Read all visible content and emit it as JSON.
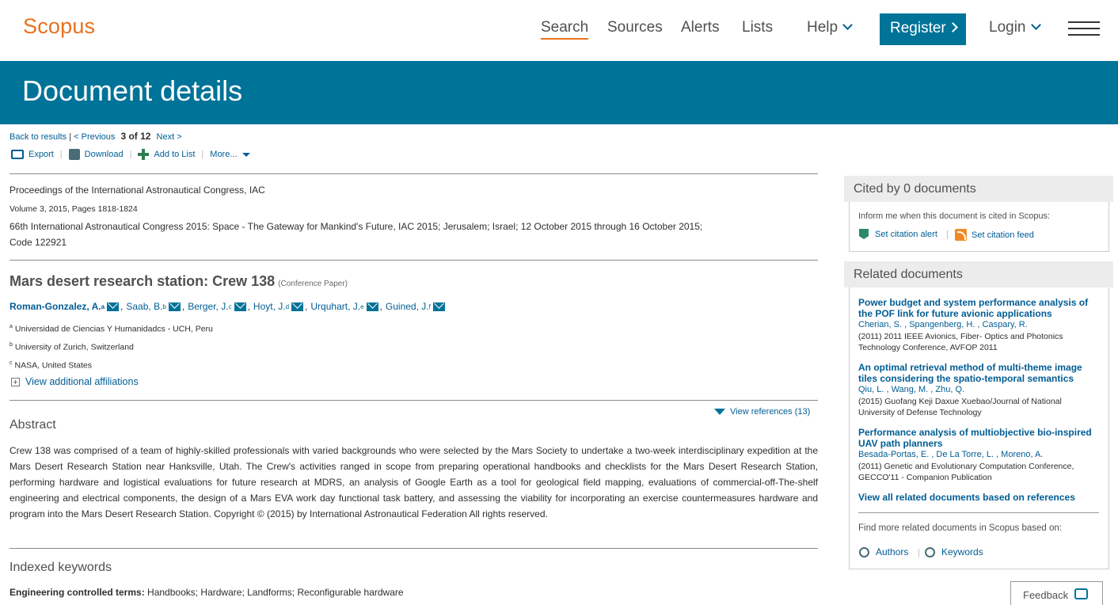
{
  "header": {
    "logo": "Scopus",
    "nav": [
      "Search",
      "Sources",
      "Alerts",
      "Lists"
    ],
    "help": "Help",
    "register": "Register",
    "login": "Login"
  },
  "banner_title": "Document details",
  "results_nav": {
    "back": "Back to results",
    "separator": "|",
    "previous": "< Previous",
    "position": "3 of 12",
    "next": "Next >"
  },
  "toolbar": {
    "export": "Export",
    "download": "Download",
    "add_to_list": "Add to List",
    "more": "More..."
  },
  "source": {
    "journal": "Proceedings of the International Astronautical Congress, IAC",
    "volume": "Volume 3, 2015, Pages 1818-1824",
    "conference_line1": "66th International Astronautical Congress 2015: Space - The Gateway for Mankind's Future, IAC 2015; Jerusalem; Israel; 12 October 2015 through 16 October 2015;",
    "conference_line2": "Code 122921"
  },
  "document": {
    "title": "Mars desert research station: Crew 138",
    "type": "(Conference Paper)"
  },
  "authors": [
    {
      "name": "Roman-Gonzalez, A.",
      "sup": "a"
    },
    {
      "name": "Saab, B.",
      "sup": "b"
    },
    {
      "name": "Berger, J.",
      "sup": "c"
    },
    {
      "name": "Hoyt, J.",
      "sup": "d"
    },
    {
      "name": "Urquhart, J.",
      "sup": "e"
    },
    {
      "name": "Guined, J.",
      "sup": "f"
    }
  ],
  "affiliations": [
    {
      "sup": "a",
      "text": "Universidad de Ciencias Y Humanidadcs - UCH, Peru"
    },
    {
      "sup": "b",
      "text": "University of Zurich, Switzerland"
    },
    {
      "sup": "c",
      "text": "NASA, United States"
    }
  ],
  "view_affiliations": "View additional affiliations",
  "abstract_heading": "Abstract",
  "view_references": "View references (13)",
  "abstract": "Crew 138 was comprised of a team of highly-skilled professionals with varied backgrounds who were selected by the Mars Society to undertake a two-week interdisciplinary expedition at the Mars Desert Research Station near Hanksville, Utah. The Crew's activities ranged in scope from preparing operational handbooks and checklists for the Mars Desert Research Station, performing hardware and logistical evaluations for future research at MDRS, an analysis of Google Earth as a tool for geological field mapping, evaluations of commercial-off-The-shelf engineering and electrical components, the design of a Mars EVA work day functional task battery, and assessing the viability for incorporating an exercise countermeasures hardware and program into the Mars Desert Research Station. Copyright © (2015) by International Astronautical Federation All rights reserved.",
  "keywords_heading": "Indexed keywords",
  "engineering_terms_label": "Engineering controlled terms:",
  "engineering_terms": "Handbooks; Hardware; Landforms; Reconfigurable hardware",
  "sidebar": {
    "cited_by": "Cited by 0 documents",
    "inform": "Inform me when this document is cited in Scopus:",
    "set_alert": "Set citation alert",
    "set_feed": "Set citation feed",
    "related_heading": "Related documents",
    "related": [
      {
        "title": "Power budget and system performance analysis of the POF link for future avionic applications",
        "authors": "Cherian, S. , Spangenberg, H. , Caspary, R.",
        "source": "(2011) 2011 IEEE Avionics, Fiber- Optics and Photonics Technology Conference, AVFOP 2011"
      },
      {
        "title": "An optimal retrieval method of multi-theme image tiles considering the spatio-temporal semantics",
        "authors": "Qiu, L. , Wang, M. , Zhu, Q.",
        "source": "(2015) Guofang Keji Daxue Xuebao/Journal of National University of Defense Technology"
      },
      {
        "title": "Performance analysis of multiobjective bio-inspired UAV path planners",
        "authors": "Besada-Portas, E. , De La Torre, L. , Moreno, A.",
        "source": "(2011) Genetic and Evolutionary Computation Conference, GECCO'11 - Companion Publication"
      }
    ],
    "view_all": "View all related documents based on references",
    "find_more": "Find more related documents in Scopus based on:",
    "authors_link": "Authors",
    "keywords_link": "Keywords"
  },
  "feedback": "Feedback"
}
